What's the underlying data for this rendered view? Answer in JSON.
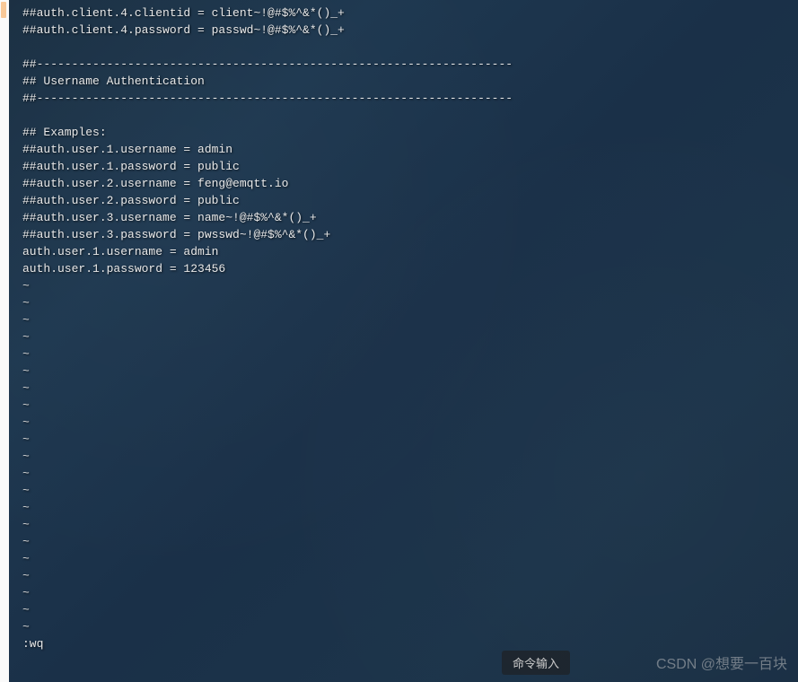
{
  "editor": {
    "lines": [
      "##auth.client.4.clientid = client~!@#$%^&*()_+",
      "##auth.client.4.password = passwd~!@#$%^&*()_+",
      "",
      "##--------------------------------------------------------------------",
      "## Username Authentication",
      "##--------------------------------------------------------------------",
      "",
      "## Examples:",
      "##auth.user.1.username = admin",
      "##auth.user.1.password = public",
      "##auth.user.2.username = feng@emqtt.io",
      "##auth.user.2.password = public",
      "##auth.user.3.username = name~!@#$%^&*()_+",
      "##auth.user.3.password = pwsswd~!@#$%^&*()_+",
      "auth.user.1.username = admin",
      "auth.user.1.password = 123456"
    ],
    "tilde_count": 21,
    "command": ":wq"
  },
  "ime": {
    "label": "命令输入"
  },
  "watermark": {
    "text": "CSDN @想要一百块"
  }
}
